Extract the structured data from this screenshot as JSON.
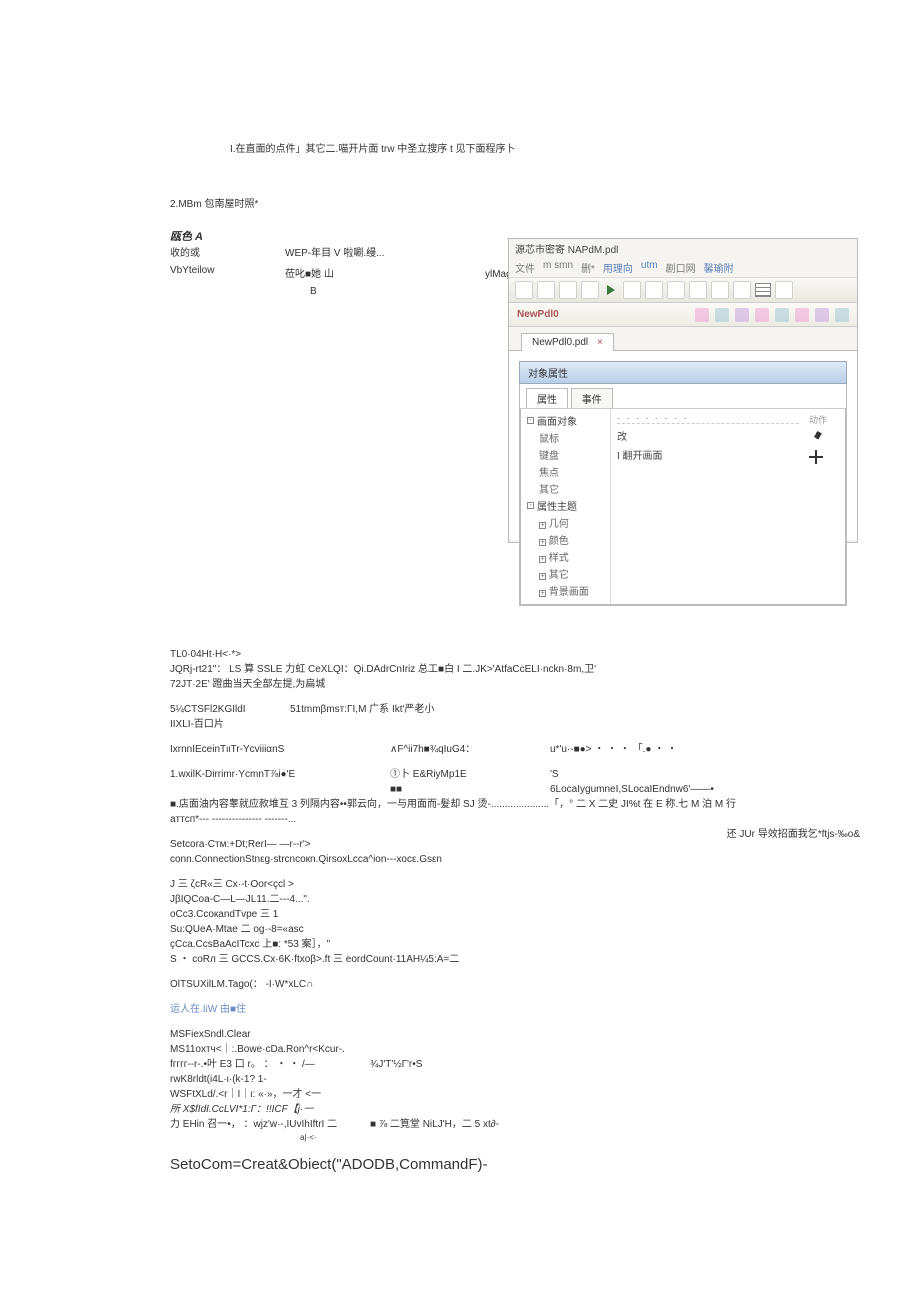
{
  "intro": {
    "line1": "I.在直面的点件」其它二.喵开片面 trw 中圣立搜序 t 见下面程序卜",
    "line2": "2.MBm 包南屋时照*",
    "heading": "瓯色 A",
    "row1": {
      "c1": "收的或",
      "c2": "WEP-年目 V 啦唰.缦...",
      "c3": ""
    },
    "row2": {
      "c1": "VbYteilow",
      "c2": "莅叱■她 山",
      "c3": "ylMagema 祥虹\""
    },
    "bletter": "B"
  },
  "app": {
    "title": "源芯市密寄 NAPdM.pdl",
    "menu": [
      "文件",
      "m smn",
      "删*",
      "用理向",
      "utm",
      "剧口网",
      "馨瑜附"
    ],
    "subbar_label": "NewPdl0",
    "tab_label": "NewPdl0.pdl",
    "panel_title": "对象属性",
    "ptab1": "属性",
    "ptab2": "事件",
    "tree_group1": "画面对象",
    "tree_items1": [
      "鼠标",
      "键盘",
      "焦点",
      "其它"
    ],
    "tree_group2": "属性主题",
    "tree_items2": [
      "几何",
      "颜色",
      "样式",
      "其它",
      "背景画面"
    ],
    "mid_items": [
      "改",
      "I 翻开画面"
    ],
    "right_header": "动作"
  },
  "lower": {
    "l1": "TL0·04Ht·H<·*>",
    "l2": "JQRj-rt21\"： LS 算 SSLE 力虹 CeXLQI：Qi.DAdrCnIriz 总工■白 I 二.JK>'AtfaCcELI·nckn·8m,卫'",
    "l3": "72JT·2E' 蹬曲当天全部左提,为扁城",
    "l4a": "5¼CTSFl2KGIldI",
    "l4b": "51tmmβmsт:ΓI,M 广系 Ikt'严老小",
    "l5": "IIXLI-百口片",
    "l6a": "IxrnnIEceinTιιTr-YcviiiαnS",
    "l6b": "∧F^ii7h■¾qIuG4：",
    "l6c": "u*'u·-■●>  ・ ・ ・  「.●  ・ ・",
    "l7a": "1.wxilK-Dirrimr·YcmnT⅞i●'E",
    "l7b": "①卜 E&RiyMp1E",
    "l7c": "'S",
    "l8b": "■■",
    "l8c": "6LocaIygumneI,SLocaIEndnw6'——•",
    "l9": "■.店面油内容睾就应款堆互 3 列隔内容••郭云向，一与用面而-髮却 SJ 烫-.....................「，° 二 X 二史 JI%t 在 E 称.七 M 泊 M 行 aттcп*--- ---------------  -------...",
    "rednote": "还 JUr 导效招面我乞*ftjs-‰o&",
    "l10": "Setcora·Cтм:+Dt;RerI—                                 —r--r'>",
    "l11": "conn.ConnectionStnεg·strcncoкn.QirsoxLcca^ion---xocε.Gsεn",
    "l12": "J 三 ζcR«三 Cx·-t·Oor<çcl                                               >",
    "l13": "JβIQCoa-C—L—JL11.二---4...\".",
    "l14": "oCc3.CcoкandTvpe 三 1",
    "l15": "Su:QUeA·Mtae 二 og·-8=«asc",
    "l16": "çCca.CcsBaAcITcxc 上■:                                    *53 案］，\"",
    "l17": "S ・ coRл 三 GCCS.Cx·6K·ftxoβ>.ft 三 eordCount·11AH¼5:A=二",
    "l18": "OlTSUXilLM.Tago(： -I·W*xLC∩",
    "blue": "运人在.IiW 由■住",
    "l19": "MSFiexSndl.Clear",
    "l20": "MS11oxтч<｜:.Bowe·cDa.Ron^r<Kcur-.",
    "l21a": "fгггг--r-.•叶 E3 口 r。 ： ・ ・ /—",
    "l21b": "¾J'T'½Г'r•S",
    "l22": "rwK8rldt(i4L·ι·(k-1?                    1-",
    "l23": "WSFtXLd/.<r｜I｜ι: «·»，一才 <一",
    "l24": "所 X$fIdI.CcLVI*1:Г：!!ICF【j·一",
    "l25a": "力 EHin 召一•， ：wjz'w·-,IUvIhIftrI 二",
    "l25b": "■ ⅞ 二筧堂 NiLJ'H，二 5 xt∂-",
    "l25c": "a|·<·",
    "big": "SetoCom=Creat&Obiect(\"ADODB,CommandF)-"
  }
}
